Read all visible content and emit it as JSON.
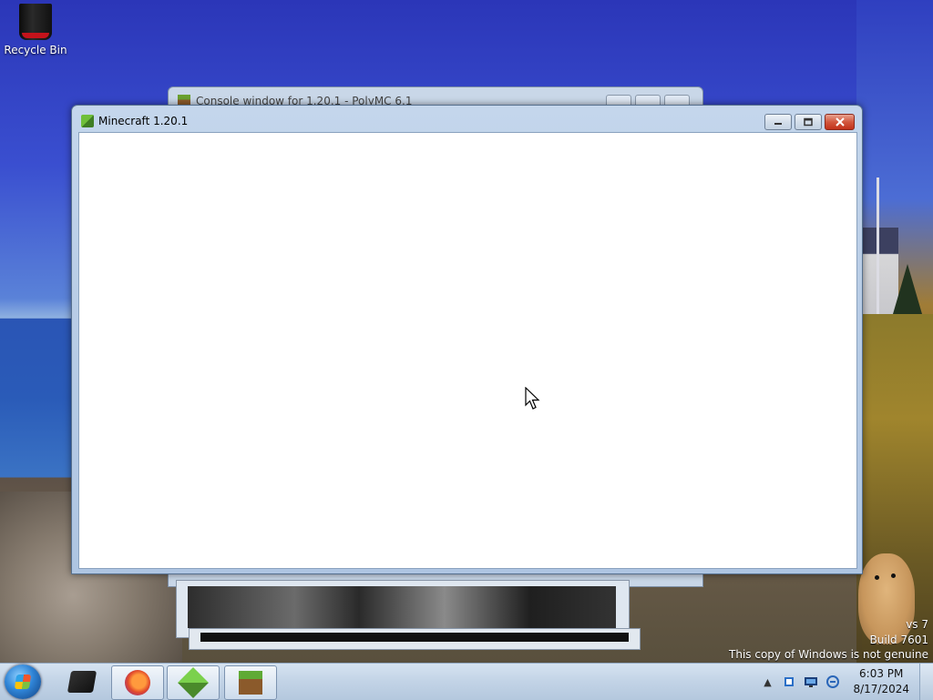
{
  "desktop": {
    "icons": [
      {
        "label": "Recycle Bin",
        "icon": "recycle-bin-icon"
      }
    ],
    "watermark": {
      "line1": "vs 7",
      "line2": "Build 7601",
      "line3": "This copy of Windows is not genuine"
    }
  },
  "windows": {
    "console": {
      "title": "Console window for 1.20.1 - PolyMC 6.1"
    },
    "minecraft": {
      "title": "Minecraft 1.20.1",
      "controls": {
        "minimize": "minimize-icon",
        "maximize": "maximize-icon",
        "close": "close-icon"
      }
    }
  },
  "taskbar": {
    "start": "windows-start-orb",
    "buttons": [
      {
        "name": "app-dark-icon"
      },
      {
        "name": "firefox-icon"
      },
      {
        "name": "prism-launcher-icon"
      },
      {
        "name": "minecraft-icon"
      }
    ],
    "tray": {
      "clock_time": "6:03 PM",
      "clock_date": "8/17/2024"
    }
  }
}
